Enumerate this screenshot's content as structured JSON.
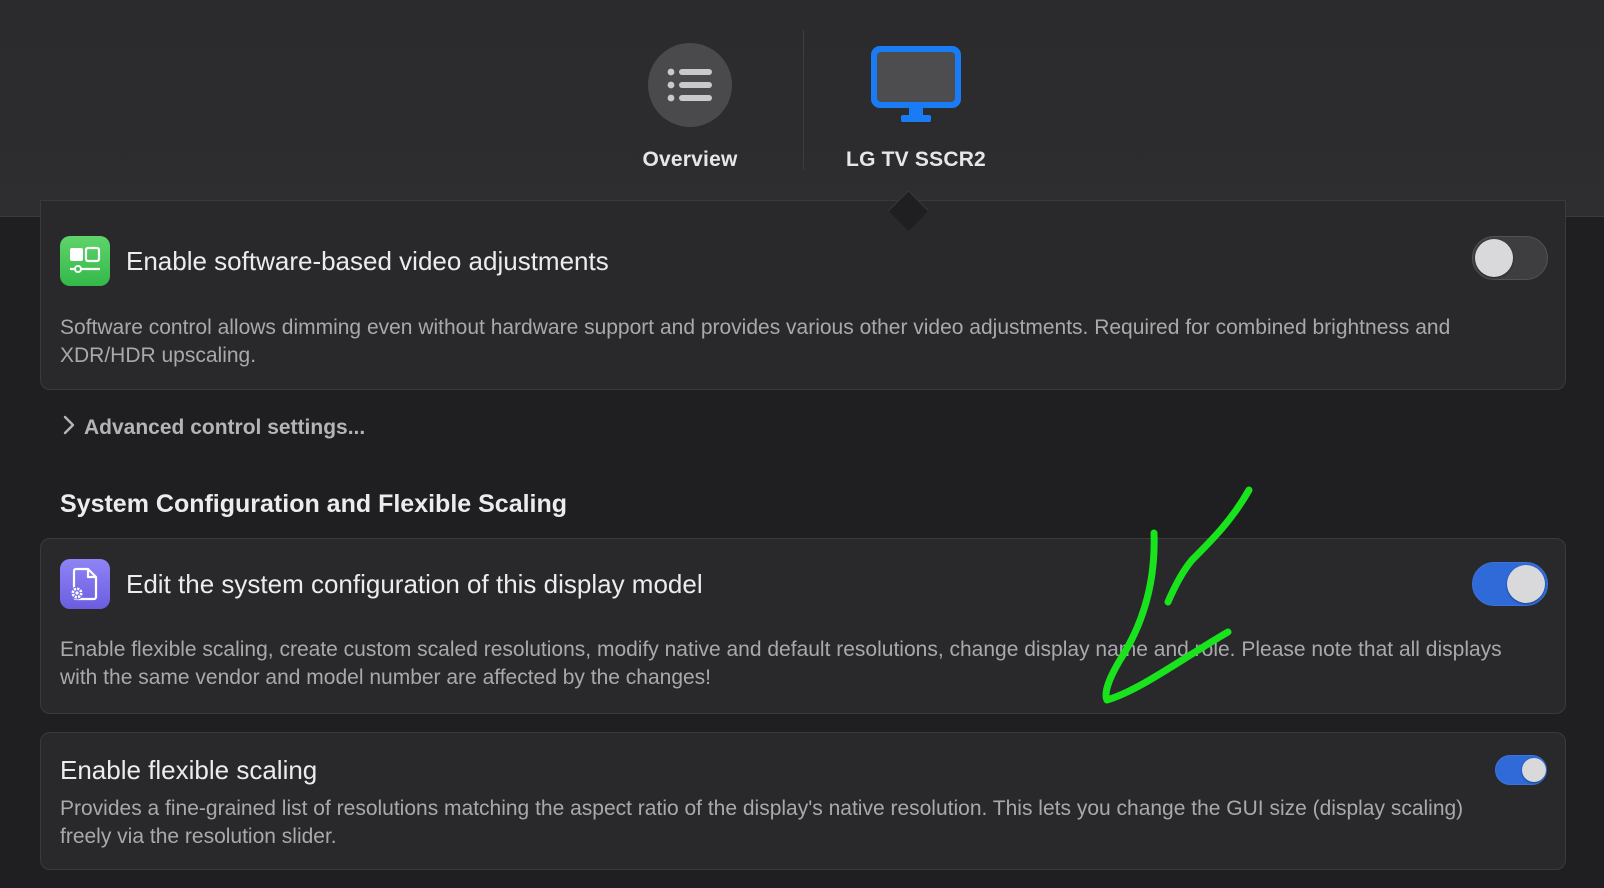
{
  "toolbar": {
    "tabs": [
      {
        "label": "Overview",
        "icon": "list-icon"
      },
      {
        "label": "LG TV SSCR2",
        "icon": "display-icon",
        "accent": "#1a7cf5"
      }
    ]
  },
  "video_adjustments": {
    "title": "Enable software-based video adjustments",
    "description": "Software control allows dimming even without hardware support and provides various other video adjustments. Required for combined brightness and XDR/HDR upscaling.",
    "enabled": false,
    "icon": "video-adjust-icon"
  },
  "advanced": {
    "label": "Advanced control settings..."
  },
  "system_section": {
    "heading": "System Configuration and Flexible Scaling",
    "edit_config": {
      "title": "Edit the system configuration of this display model",
      "description": "Enable flexible scaling, create custom scaled resolutions, modify native and default resolutions, change display name and role. Please note that all displays with the same vendor and model number are affected by the changes!",
      "enabled": true,
      "icon": "config-document-icon"
    },
    "flexible_scaling": {
      "title": "Enable flexible scaling",
      "description": "Provides a fine-grained list of resolutions matching the aspect ratio of the display's native resolution. This lets you change the GUI size (display scaling) freely via the resolution slider.",
      "enabled": true
    }
  },
  "colors": {
    "toggle_on": "#2f6ad8",
    "annotation": "#18e31c"
  }
}
